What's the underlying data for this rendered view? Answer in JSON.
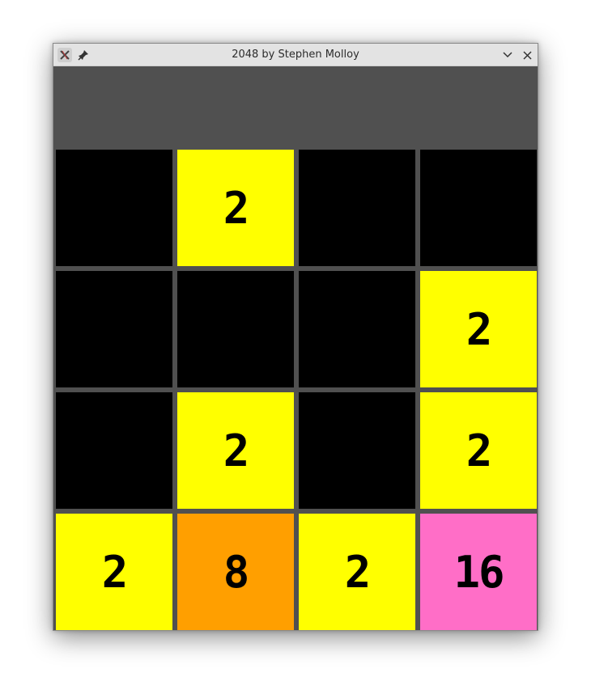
{
  "window": {
    "title": "2048 by Stephen Molloy",
    "app_icon": "x-app-icon",
    "pin_icon": "pin-icon",
    "minimize_icon": "chevron-down-icon",
    "close_icon": "close-icon"
  },
  "score_area": {},
  "board": {
    "rows": [
      [
        {
          "value": ""
        },
        {
          "value": "2",
          "color": "#ffff00"
        },
        {
          "value": ""
        },
        {
          "value": ""
        }
      ],
      [
        {
          "value": ""
        },
        {
          "value": ""
        },
        {
          "value": ""
        },
        {
          "value": "2",
          "color": "#ffff00"
        }
      ],
      [
        {
          "value": ""
        },
        {
          "value": "2",
          "color": "#ffff00"
        },
        {
          "value": ""
        },
        {
          "value": "2",
          "color": "#ffff00"
        }
      ],
      [
        {
          "value": "2",
          "color": "#ffff00"
        },
        {
          "value": "8",
          "color": "#ff9f00"
        },
        {
          "value": "2",
          "color": "#ffff00"
        },
        {
          "value": "16",
          "color": "#ff6ec7"
        }
      ]
    ]
  },
  "colors": {
    "empty_cell": "#000000",
    "grid_background": "#505050",
    "tile_2": "#ffff00",
    "tile_8": "#ff9f00",
    "tile_16": "#ff6ec7"
  }
}
